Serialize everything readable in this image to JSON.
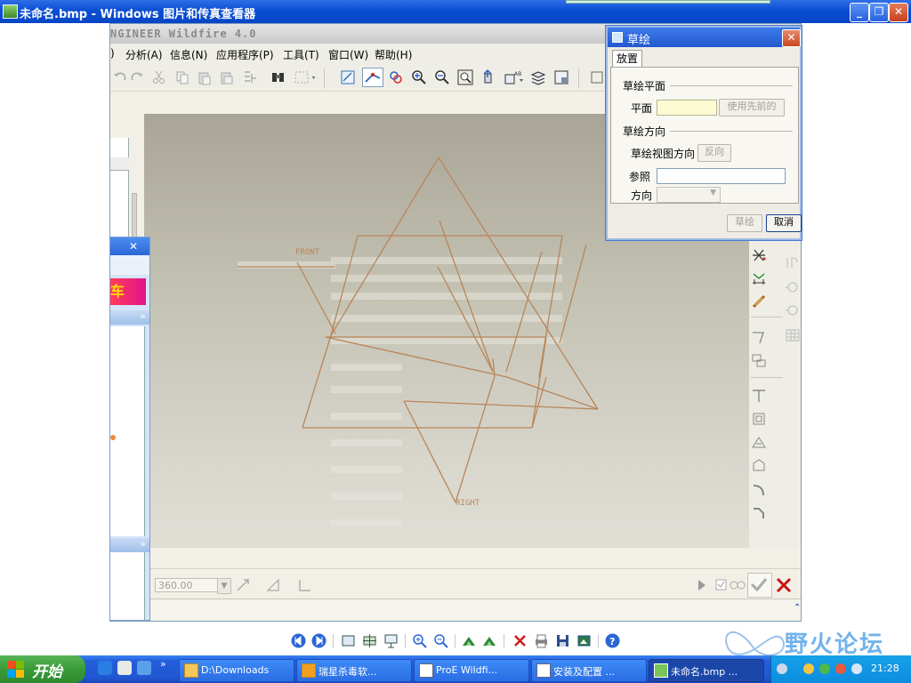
{
  "outer_window": {
    "title": "未命名.bmp - Windows 图片和传真查看器"
  },
  "proe": {
    "title": "NGINEER Wildfire 4.0",
    "menu": [
      ")",
      "分析(A)",
      "信息(N)",
      "应用程序(P)",
      "工具(T)",
      "窗口(W)",
      "帮助(H)"
    ],
    "datum_labels": {
      "front": "FRONT",
      "right": "RIGHT"
    },
    "depth_value": "360.00"
  },
  "side_panel": {
    "close": "✕",
    "banner_text": "车",
    "chevron": "»"
  },
  "sketch_dialog": {
    "title": "草绘",
    "tab": "放置",
    "section_plane": "草绘平面",
    "plane_label": "平面",
    "use_prev_button": "使用先前的",
    "section_orient": "草绘方向",
    "view_dir_label": "草绘视图方向",
    "flip_button": "反向",
    "reference_label": "参照",
    "orientation_label": "方向",
    "sketch_button": "草绘",
    "cancel_button": "取消"
  },
  "taskbar": {
    "start": "开始",
    "items": [
      "D:\\Downloads",
      "瑞星杀毒软...",
      "ProE Wildfi...",
      "安装及配置 ...",
      "未命名.bmp ..."
    ],
    "clock": "21:28"
  },
  "watermark": {
    "text": "野火论坛"
  },
  "colors": {
    "sketch_line": "#b9855a",
    "xp_blue": "#0a4ed3",
    "canvas_top": "#a9a596"
  }
}
